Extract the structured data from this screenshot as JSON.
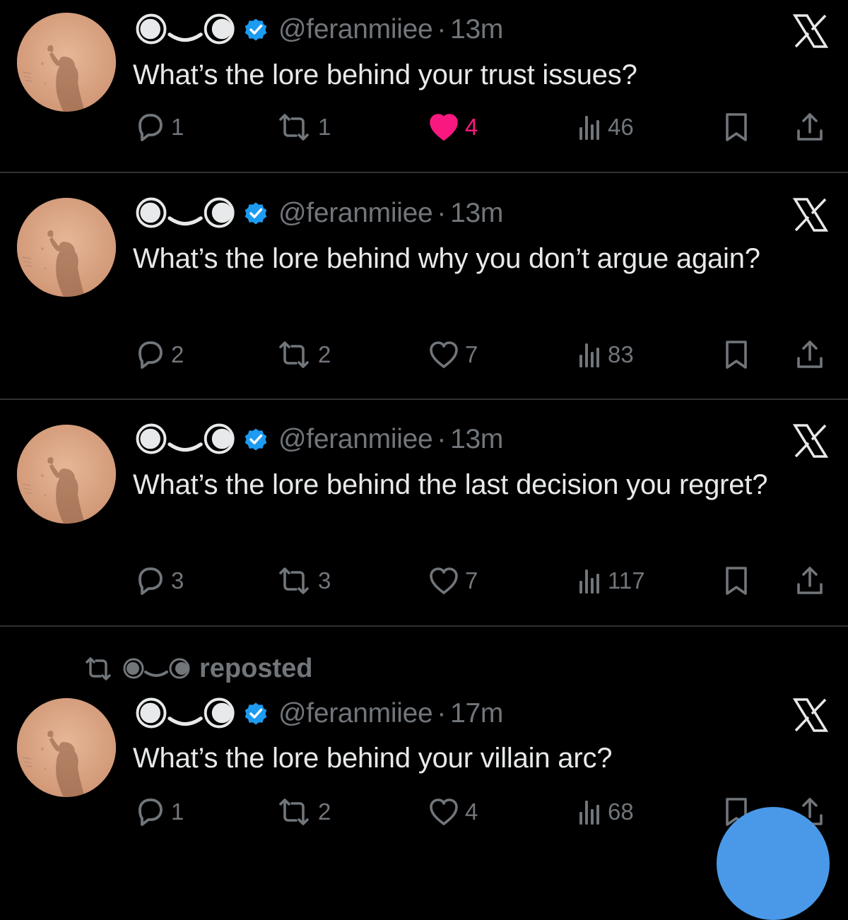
{
  "colors": {
    "background": "#000000",
    "text": "#e7e9ea",
    "muted": "#71767b",
    "divider": "#2f3336",
    "verified": "#1d9bf0",
    "like_active": "#f91880",
    "fab": "#4a99e9"
  },
  "icons": {
    "reply": "speech-bubble-icon",
    "repost": "repost-arrows-icon",
    "like": "heart-icon",
    "views": "bar-chart-icon",
    "bookmark": "bookmark-icon",
    "share": "share-upload-icon",
    "verified": "verified-badge-icon",
    "close": "x-icon"
  },
  "repost_banner": {
    "label": "reposted"
  },
  "tweets": [
    {
      "handle": "@feranmiiee",
      "separator": "·",
      "time": "13m",
      "text": "What’s the lore behind your trust issues?",
      "replies": "1",
      "reposts": "1",
      "likes": "4",
      "liked": true,
      "views": "46"
    },
    {
      "handle": "@feranmiiee",
      "separator": "·",
      "time": "13m",
      "text": "What’s the lore behind why you don’t argue again?",
      "replies": "2",
      "reposts": "2",
      "likes": "7",
      "liked": false,
      "views": "83"
    },
    {
      "handle": "@feranmiiee",
      "separator": "·",
      "time": "13m",
      "text": "What’s the lore behind the last decision you regret?",
      "replies": "3",
      "reposts": "3",
      "likes": "7",
      "liked": false,
      "views": "117"
    },
    {
      "handle": "@feranmiiee",
      "separator": "·",
      "time": "17m",
      "text": "What’s the lore behind your villain arc?",
      "replies": "1",
      "reposts": "2",
      "likes": "4",
      "liked": false,
      "views": "68"
    }
  ]
}
